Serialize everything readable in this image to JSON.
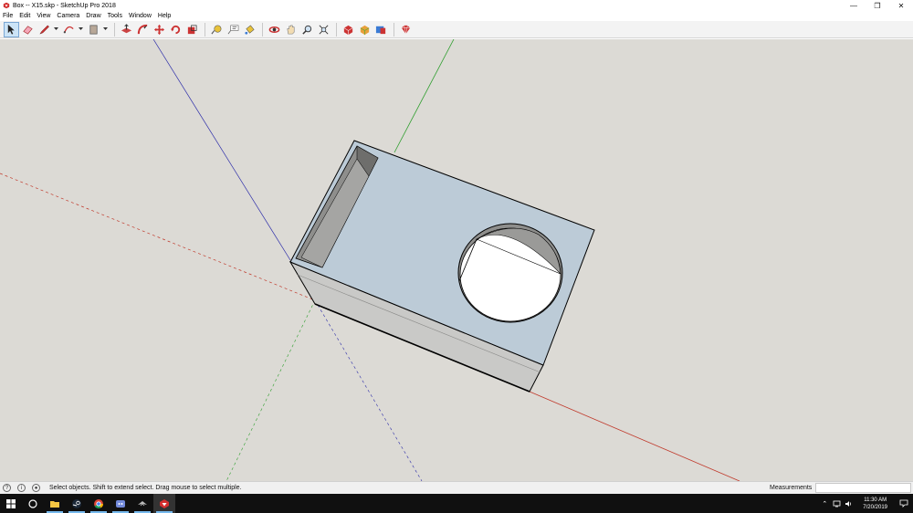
{
  "window": {
    "title": "Box -- X15.skp - SketchUp Pro 2018",
    "minimize_glyph": "—",
    "restore_glyph": "❐",
    "close_glyph": "✕"
  },
  "menu": {
    "items": [
      "File",
      "Edit",
      "View",
      "Camera",
      "Draw",
      "Tools",
      "Window",
      "Help"
    ]
  },
  "toolbar": {
    "tools": [
      "select",
      "eraser",
      "line",
      "arc",
      "shape",
      "push-pull",
      "follow-me",
      "move",
      "rotate",
      "scale",
      "tape-measure",
      "text",
      "paint-bucket",
      "orbit",
      "pan",
      "zoom",
      "zoom-extents",
      "3d-warehouse",
      "extension-warehouse",
      "layout",
      "ruby"
    ],
    "active_tool": "select"
  },
  "viewport": {
    "background": "#dcdad5",
    "top_face_color": "#bccbd7",
    "side_face_color": "#c9c9c7",
    "axis_red": "#c0392b",
    "axis_green": "#2e9e2e",
    "axis_blue": "#2b2ba8"
  },
  "status": {
    "text": "Select objects. Shift to extend select. Drag mouse to select multiple.",
    "measurements_label": "Measurements",
    "measurements_value": ""
  },
  "taskbar": {
    "apps": [
      "start",
      "cortana",
      "file-explorer",
      "steam",
      "chrome",
      "discord",
      "app",
      "sketchup"
    ],
    "time": "11:30 AM",
    "date": "7/20/2019"
  }
}
